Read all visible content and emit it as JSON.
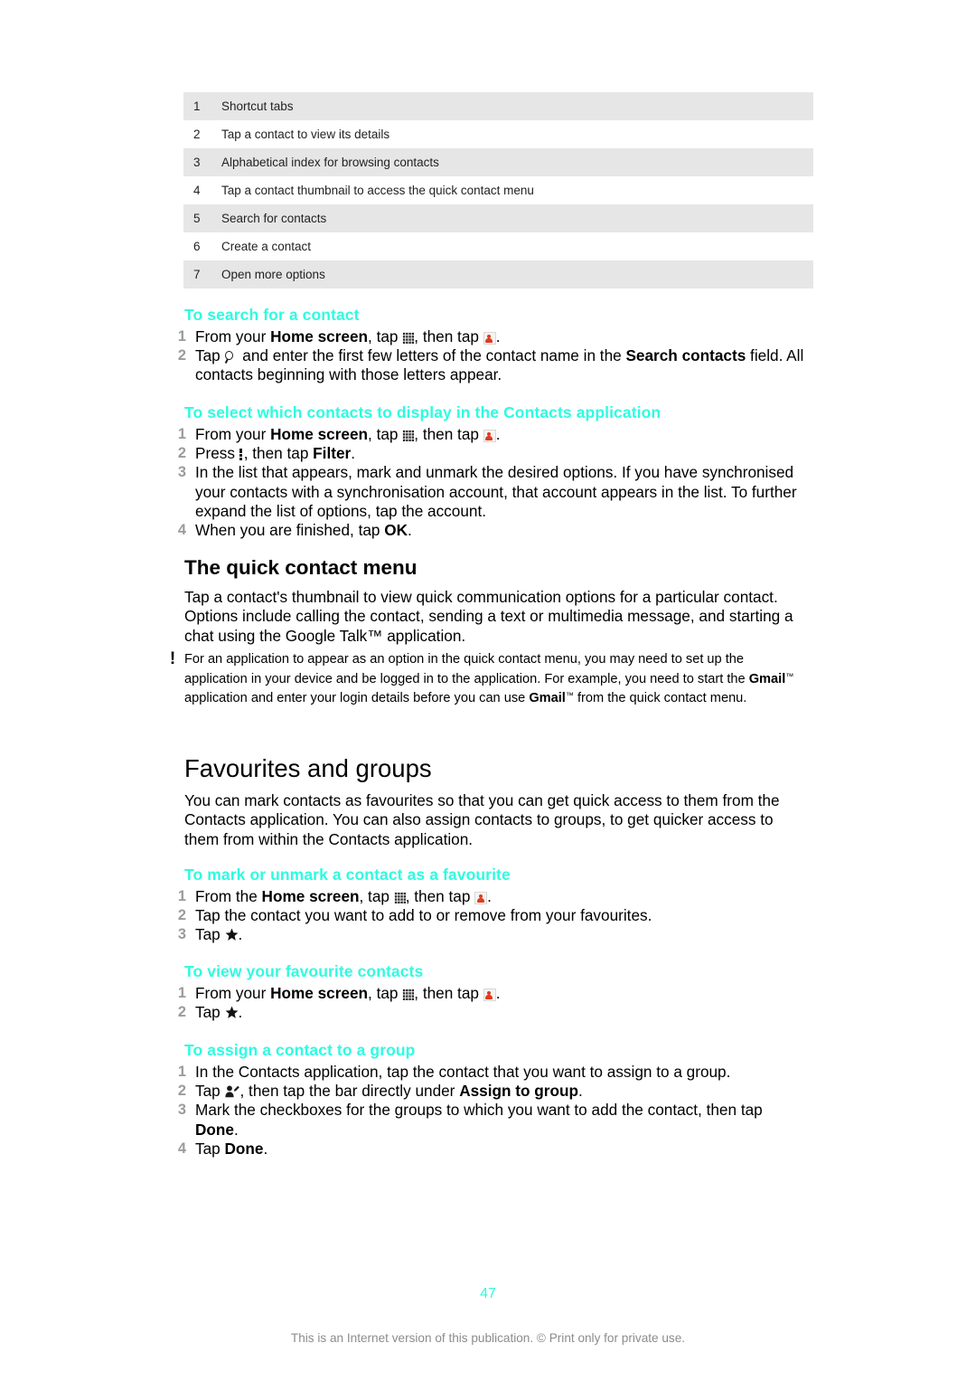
{
  "legend": {
    "rows": [
      {
        "num": "1",
        "text": "Shortcut tabs"
      },
      {
        "num": "2",
        "text": "Tap a contact to view its details"
      },
      {
        "num": "3",
        "text": "Alphabetical index for browsing contacts"
      },
      {
        "num": "4",
        "text": "Tap a contact thumbnail to access the quick contact menu"
      },
      {
        "num": "5",
        "text": "Search for contacts"
      },
      {
        "num": "6",
        "text": "Create a contact"
      },
      {
        "num": "7",
        "text": "Open more options"
      }
    ]
  },
  "sections": {
    "search_contact": {
      "heading": "To search for a contact",
      "steps": [
        {
          "num": "1"
        },
        {
          "num": "2"
        }
      ]
    },
    "select_contacts": {
      "heading": "To select which contacts to display in the Contacts application",
      "steps": [
        {
          "num": "1"
        },
        {
          "num": "2"
        },
        {
          "num": "3"
        },
        {
          "num": "4"
        }
      ],
      "step3_text": "In the list that appears, mark and unmark the desired options. If you have synchronised your contacts with a synchronisation account, that account appears in the list. To further expand the list of options, tap the account.",
      "step4_prefix": "When you are finished, tap ",
      "step4_bold": "OK",
      "step4_suffix": "."
    },
    "quick_contact_menu": {
      "heading": "The quick contact menu",
      "paragraph": "Tap a contact's thumbnail to view quick communication options for a particular contact. Options include calling the contact, sending a text or multimedia message, and starting a chat using the Google Talk™ application."
    },
    "note": {
      "icon": "exclamation-icon",
      "part1": "For an application to appear as an option in the quick contact menu, you may need to set up the application in your device and be logged in to the application. For example, you need to start the ",
      "gmail1": "Gmail",
      "part2": " application and enter your login details before you can use ",
      "gmail2": "Gmail",
      "part3": " from the quick contact menu."
    },
    "favourites_and_groups": {
      "heading": "Favourites and groups",
      "paragraph": "You can mark contacts as favourites so that you can get quick access to them from the Contacts application. You can also assign contacts to groups, to get quicker access to them from within the Contacts application."
    },
    "mark_favourite": {
      "heading": "To mark or unmark a contact as a favourite",
      "step1_prefix": "From the ",
      "step1_bold": "Home screen",
      "step1_mid": ", tap ",
      "step1_mid2": ", then tap ",
      "step1_suffix": ".",
      "step2_text": "Tap the contact you want to add to or remove from your favourites.",
      "step3_prefix": "Tap ",
      "step3_suffix": "."
    },
    "view_favourites": {
      "heading": "To view your favourite contacts",
      "step2_prefix": "Tap ",
      "step2_suffix": "."
    },
    "assign_group": {
      "heading": "To assign a contact to a group",
      "step1_text": "In the Contacts application, tap the contact that you want to assign to a group.",
      "step2_prefix": "Tap ",
      "step2_mid": ", then tap the bar directly under ",
      "step2_bold": "Assign to group",
      "step2_suffix": ".",
      "step3_prefix": "Mark the checkboxes for the groups to which you want to add the contact, then tap ",
      "step3_bold": "Done",
      "step3_suffix": ".",
      "step4_prefix": "Tap ",
      "step4_bold": "Done",
      "step4_suffix": "."
    },
    "common": {
      "from_your": "From your ",
      "from_the": "From the ",
      "home_screen": "Home screen",
      "tap_comma": ", tap ",
      "then_tap": ", then tap ",
      "period": ".",
      "press": "Press ",
      "then_tap_plain": ", then tap ",
      "filter": "Filter",
      "tap_word": "Tap ",
      "search_step_a": " and enter the first few letters of the contact name in the ",
      "search_bold": "Search contacts",
      "search_step_b": " field. All contacts beginning with those letters appear."
    }
  },
  "footer": {
    "page_number": "47",
    "note": "This is an Internet version of this publication. © Print only for private use."
  },
  "colors": {
    "teal_heading": "#2FFBE0",
    "table_shade": "#E6E6E6",
    "step_number": "#9B9B9B",
    "footer_gray": "#8C8C8C",
    "contacts_icon_red": "#E03A20"
  }
}
